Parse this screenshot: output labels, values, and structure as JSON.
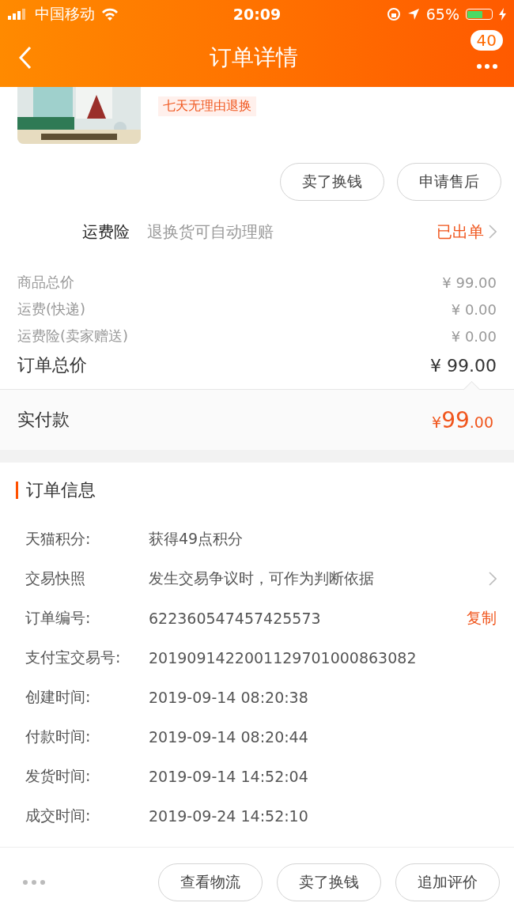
{
  "status_bar": {
    "carrier": "中国移动",
    "time": "20:09",
    "battery": "65%"
  },
  "nav": {
    "title": "订单详情",
    "badge": "40"
  },
  "product": {
    "tag": "七天无理由退换"
  },
  "item_actions": [
    "卖了换钱",
    "申请售后"
  ],
  "insurance": {
    "label": "运费险",
    "description": "退换货可自动理赔",
    "status": "已出单"
  },
  "price_rows": [
    {
      "label": "商品总价",
      "value": "¥ 99.00"
    },
    {
      "label": "运费(快递)",
      "value": "¥ 0.00"
    },
    {
      "label": "运费险(卖家赠送)",
      "value": "¥ 0.00"
    }
  ],
  "total": {
    "label": "订单总价",
    "value": "¥ 99.00"
  },
  "paid": {
    "label": "实付款",
    "currency": "¥",
    "integer": "99",
    "decimal": ".00"
  },
  "order_info": {
    "title": "订单信息",
    "rows": [
      {
        "label": "天猫积分:",
        "value": "获得49点积分"
      },
      {
        "label": "交易快照",
        "value": "发生交易争议时，可作为判断依据",
        "kind": "link"
      },
      {
        "label": "订单编号:",
        "value": "622360547457425573",
        "kind": "copy",
        "action": "复制"
      },
      {
        "label": "支付宝交易号:",
        "value": "2019091422001129701000863082"
      },
      {
        "label": "创建时间:",
        "value": "2019-09-14 08:20:38"
      },
      {
        "label": "付款时间:",
        "value": "2019-09-14 08:20:44"
      },
      {
        "label": "发货时间:",
        "value": "2019-09-14 14:52:04"
      },
      {
        "label": "成交时间:",
        "value": "2019-09-24 14:52:10"
      }
    ]
  },
  "bottom_actions": [
    "查看物流",
    "卖了换钱",
    "追加评价"
  ]
}
